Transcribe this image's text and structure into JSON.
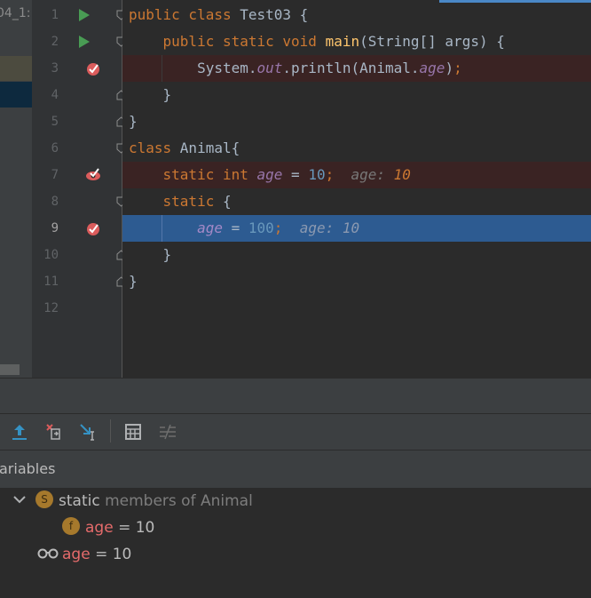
{
  "project_panel": {
    "tab_label": "04_1:"
  },
  "editor": {
    "line_numbers": [
      "1",
      "2",
      "3",
      "4",
      "5",
      "6",
      "7",
      "8",
      "9",
      "10",
      "11",
      "12"
    ],
    "active_line": "9",
    "lines": [
      {
        "tokens": [
          {
            "t": "public class ",
            "c": "kw"
          },
          {
            "t": "Test03 {",
            "c": ""
          }
        ]
      },
      {
        "tokens": [
          {
            "t": "    public static void ",
            "c": "kw"
          },
          {
            "t": "main",
            "c": "fn"
          },
          {
            "t": "(String[] args) {",
            "c": ""
          }
        ]
      },
      {
        "tokens": [
          {
            "t": "        System.",
            "c": ""
          },
          {
            "t": "out",
            "c": "st"
          },
          {
            "t": ".println(Animal.",
            "c": ""
          },
          {
            "t": "age",
            "c": "st"
          },
          {
            "t": ")",
            "c": ""
          },
          {
            "t": ";",
            "c": "kw"
          }
        ]
      },
      {
        "tokens": [
          {
            "t": "    }",
            "c": ""
          }
        ]
      },
      {
        "tokens": [
          {
            "t": "}",
            "c": ""
          }
        ]
      },
      {
        "tokens": [
          {
            "t": "class ",
            "c": "kw"
          },
          {
            "t": "Animal{",
            "c": ""
          }
        ]
      },
      {
        "tokens": [
          {
            "t": "    static int ",
            "c": "kw"
          },
          {
            "t": "age",
            "c": "st"
          },
          {
            "t": " = ",
            "c": ""
          },
          {
            "t": "10",
            "c": "num"
          },
          {
            "t": ";",
            "c": "kw"
          },
          {
            "t": "  age: ",
            "c": "hint"
          },
          {
            "t": "10",
            "c": "hintv"
          }
        ]
      },
      {
        "tokens": [
          {
            "t": "    static ",
            "c": "kw"
          },
          {
            "t": "{",
            "c": ""
          }
        ]
      },
      {
        "tokens": [
          {
            "t": "        ",
            "c": ""
          },
          {
            "t": "age",
            "c": "st"
          },
          {
            "t": " = ",
            "c": ""
          },
          {
            "t": "100",
            "c": "num"
          },
          {
            "t": ";",
            "c": "kw"
          },
          {
            "t": "  age: 10",
            "c": "hint"
          }
        ]
      },
      {
        "tokens": [
          {
            "t": "    }",
            "c": ""
          }
        ]
      },
      {
        "tokens": [
          {
            "t": "}",
            "c": ""
          }
        ]
      },
      {
        "tokens": []
      }
    ],
    "inline_hint_line7": "age: 10",
    "inline_hint_line9": "age: 10"
  },
  "debugger": {
    "toolbar": {
      "buttons": [
        "step-out-icon",
        "drop-frame-icon",
        "run-to-cursor-icon",
        "evaluate-expression-icon",
        "trace-icon"
      ]
    },
    "variables_header": "ariables",
    "tree": {
      "group": {
        "badge": "S",
        "label_keyword": "static",
        "label_rest": " members of Animal"
      },
      "field": {
        "badge": "f",
        "name": "age",
        "eq": " = ",
        "value": "10"
      },
      "watch": {
        "name": "age",
        "eq": " = ",
        "value": "10"
      }
    }
  },
  "colors": {
    "keyword": "#cc7832",
    "method": "#ffc66d",
    "static_field": "#9876aa",
    "number": "#6897bb",
    "breakpoint_line": "#3a2323",
    "execution_line": "#2d5b91",
    "run_marker": "#499c54",
    "breakpoint": "#db5c5c"
  }
}
